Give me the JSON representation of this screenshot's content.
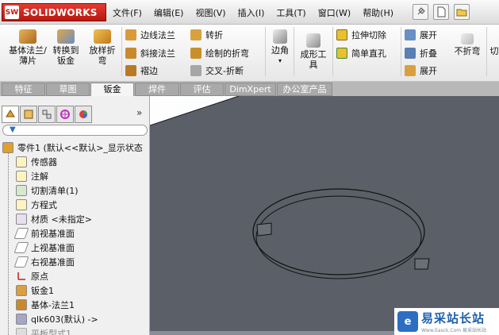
{
  "app": {
    "logo_badge": "SW",
    "name": "SOLIDWORKS"
  },
  "menu": [
    "文件(F)",
    "编辑(E)",
    "视图(V)",
    "插入(I)",
    "工具(T)",
    "窗口(W)",
    "帮助(H)"
  ],
  "top_tools": [
    "pin-icon",
    "new-doc-icon",
    "open-icon"
  ],
  "toolbar": {
    "base_flange": "基体法兰/薄片",
    "convert_sheet": "转换到钣金",
    "lofted_bend": "放样折弯",
    "edge_flange": "边线法兰",
    "miter_flange": "斜接法兰",
    "hem": "褶边",
    "jog": "转折",
    "sketched_bend": "绘制的折弯",
    "cross_break": "交叉-折断",
    "corner": "边角",
    "forming_tool": "成形工具",
    "extruded_cut": "拉伸切除",
    "simple_hole": "简单直孔",
    "unfold": "展开",
    "fold": "折叠",
    "flatten": "展开",
    "no_bends": "不折弯",
    "more": "切"
  },
  "tabs": [
    "特征",
    "草图",
    "钣金",
    "焊件",
    "评估",
    "DimXpert",
    "办公室产品"
  ],
  "active_tab": 2,
  "panel": {
    "tabs": [
      "feature-manager-icon",
      "property-manager-icon",
      "configuration-manager-icon",
      "dimxpert-manager-icon",
      "display-manager-icon"
    ],
    "expand_symbol": "»",
    "filter_symbol": "▼"
  },
  "tree": [
    {
      "label": "零件1 (默认<<默认>_显示状态",
      "icon": "part-icon",
      "indent": 0
    },
    {
      "label": "传感器",
      "icon": "sensor-icon",
      "indent": 1
    },
    {
      "label": "注解",
      "icon": "annotation-icon",
      "indent": 1
    },
    {
      "label": "切割清单(1)",
      "icon": "cut-list-icon",
      "indent": 1
    },
    {
      "label": "方程式",
      "icon": "equation-icon",
      "indent": 1
    },
    {
      "label": "材质 <未指定>",
      "icon": "material-icon",
      "indent": 1
    },
    {
      "label": "前视基准面",
      "icon": "plane-icon",
      "indent": 1
    },
    {
      "label": "上视基准面",
      "icon": "plane-icon",
      "indent": 1
    },
    {
      "label": "右视基准面",
      "icon": "plane-icon",
      "indent": 1
    },
    {
      "label": "原点",
      "icon": "origin-icon",
      "indent": 1
    },
    {
      "label": "钣金1",
      "icon": "sheet-metal-icon",
      "indent": 1
    },
    {
      "label": "基体-法兰1",
      "icon": "base-flange-icon",
      "indent": 1
    },
    {
      "label": "qlk603(默认) ->",
      "icon": "forming-tool-icon",
      "indent": 1
    },
    {
      "label": "平板型式1",
      "icon": "flat-pattern-icon",
      "indent": 1
    }
  ],
  "view_tools": [
    "zoom-to-fit-icon",
    "zoom-area-icon",
    "previous-view-icon",
    "section-view-icon",
    "view-orientation-icon",
    "display-style-icon"
  ],
  "colors": {
    "part_face": "#5b5f67",
    "part_edge": "#1a1a1a",
    "accent": "#c41b12"
  },
  "watermark": {
    "badge": "e",
    "text": "易采站长站",
    "sub": "Www.Easck.Com  易采站长站"
  }
}
